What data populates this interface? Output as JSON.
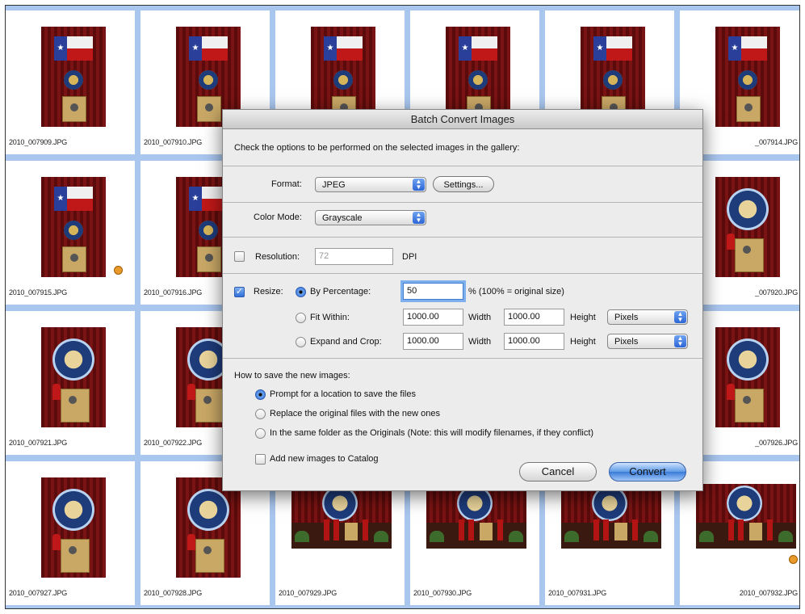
{
  "thumbnails": [
    {
      "filename": "2010_007909.JPG",
      "kind": "flag",
      "badge": false
    },
    {
      "filename": "2010_007910.JPG",
      "kind": "flag",
      "badge": false
    },
    {
      "filename": "",
      "kind": "flag",
      "badge": false
    },
    {
      "filename": "",
      "kind": "flag",
      "badge": false
    },
    {
      "filename": "",
      "kind": "flag",
      "badge": false
    },
    {
      "filename": "2010_007914.JPG",
      "kind": "flag",
      "badge": false
    },
    {
      "filename": "2010_007915.JPG",
      "kind": "flag",
      "badge": true
    },
    {
      "filename": "2010_007916.JPG",
      "kind": "flag",
      "badge": false
    },
    {
      "filename": "",
      "kind": "seal",
      "badge": false
    },
    {
      "filename": "",
      "kind": "seal",
      "badge": false
    },
    {
      "filename": "",
      "kind": "seal",
      "badge": false
    },
    {
      "filename": "2010_007920.JPG",
      "kind": "seal",
      "badge": false
    },
    {
      "filename": "2010_007921.JPG",
      "kind": "seal",
      "badge": false
    },
    {
      "filename": "2010_007922.JPG",
      "kind": "seal",
      "badge": false
    },
    {
      "filename": "",
      "kind": "seal",
      "badge": false
    },
    {
      "filename": "",
      "kind": "seal",
      "badge": false
    },
    {
      "filename": "",
      "kind": "seal",
      "badge": false
    },
    {
      "filename": "2010_007926.JPG",
      "kind": "seal",
      "badge": false
    },
    {
      "filename": "2010_007927.JPG",
      "kind": "seal",
      "badge": false
    },
    {
      "filename": "2010_007928.JPG",
      "kind": "seal",
      "badge": false
    },
    {
      "filename": "2010_007929.JPG",
      "kind": "landscape",
      "badge": false
    },
    {
      "filename": "2010_007930.JPG",
      "kind": "landscape",
      "badge": false
    },
    {
      "filename": "2010_007931.JPG",
      "kind": "landscape",
      "badge": false
    },
    {
      "filename": "2010_007932.JPG",
      "kind": "landscape",
      "badge": true
    }
  ],
  "dialog": {
    "title": "Batch Convert Images",
    "instructions": "Check the options to be performed on the selected images in the gallery:",
    "format_label": "Format:",
    "format_value": "JPEG",
    "settings_button": "Settings...",
    "color_mode_label": "Color Mode:",
    "color_mode_value": "Grayscale",
    "resolution_label": "Resolution:",
    "resolution_checked": false,
    "resolution_value": "72",
    "resolution_unit": "DPI",
    "resize_label": "Resize:",
    "resize_checked": true,
    "by_percentage_label": "By Percentage:",
    "percentage_value": "50",
    "percentage_note": "% (100% = original size)",
    "fit_within_label": "Fit Within:",
    "fit_width": "1000.00",
    "fit_height": "1000.00",
    "expand_crop_label": "Expand and Crop:",
    "crop_width": "1000.00",
    "crop_height": "1000.00",
    "width_label": "Width",
    "height_label": "Height",
    "units_value": "Pixels",
    "save_heading": "How to save the new images:",
    "save_option_1": "Prompt for a location to save the files",
    "save_option_2": "Replace the original files with the new ones",
    "save_option_3": "In the same folder as the Originals (Note: this will modify filenames, if they conflict)",
    "add_catalog_label": "Add new images to Catalog",
    "cancel_button": "Cancel",
    "convert_button": "Convert"
  },
  "colors": {
    "selection_blue": "#a9c6ee",
    "badge_orange": "#e89a2a",
    "default_button": "#3a7bd9"
  }
}
